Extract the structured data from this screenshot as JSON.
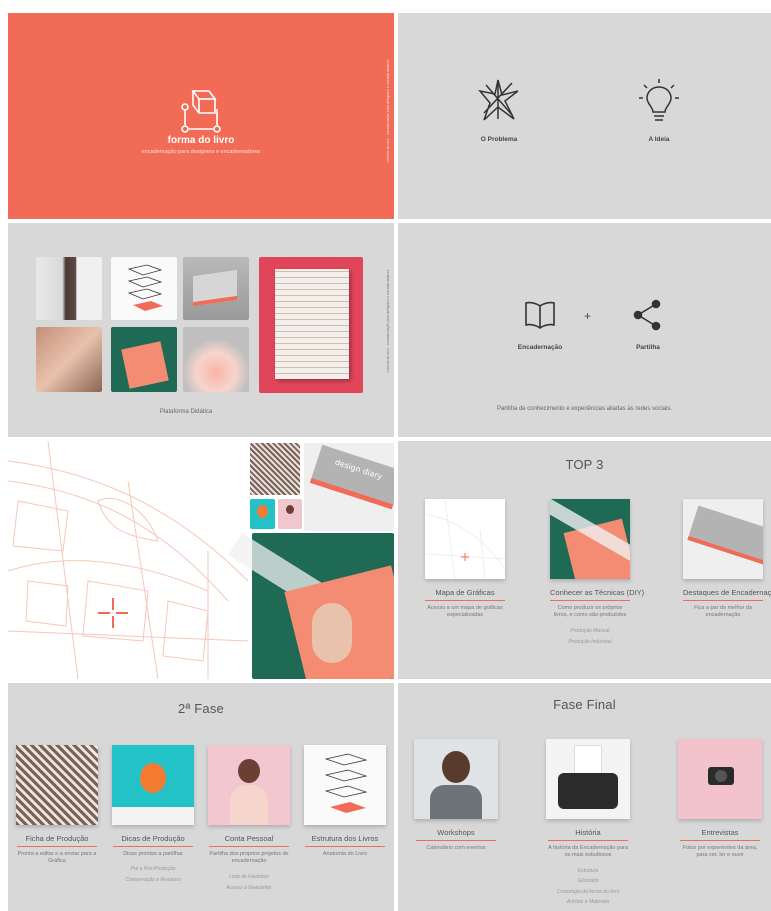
{
  "brand": {
    "name": "forma do livro",
    "tagline": "encadernação para designers e encadernadores",
    "vertical_note": "a forma do livro - encadernação para designers e encadernadores",
    "accent": "#f26b56",
    "bg_gray": "#d8d8d8"
  },
  "concepts": {
    "problem_label": "O Problema",
    "idea_label": "A Ideia",
    "problem_icon": "star-scribble-icon",
    "idea_icon": "lightbulb-icon"
  },
  "platform": {
    "caption": "Plataforma Didática"
  },
  "sharing": {
    "left_label": "Encadernação",
    "plus": "+",
    "right_label": "Partilha",
    "caption": "Partilha de conhecimento e experiências aliadas às redes sociais."
  },
  "top3": {
    "title": "TOP 3",
    "cards": [
      {
        "name": "Mapa de Gráficas",
        "desc": "Acesso a um mapa de gráficas especializadas",
        "subs": []
      },
      {
        "name": "Conhecer as Técnicas (DIY)",
        "desc": "Como produzir os próprios livros, e como são produzidos",
        "subs": [
          "Produção Manual",
          "Produção Industrial"
        ]
      },
      {
        "name": "Destaques de Encadernação",
        "desc": "Fica a par do melhor da encadernação",
        "subs": []
      }
    ]
  },
  "phase2": {
    "title": "2ª Fase",
    "cards": [
      {
        "name": "Ficha de Produção",
        "desc": "Pronta a editar e a enviar para a Gráfica",
        "subs": []
      },
      {
        "name": "Dicas de Produção",
        "desc": "Dicas prontas a partilhar",
        "subs": [
          "Pré e Pós-Produção",
          "Conservação e Restauro"
        ]
      },
      {
        "name": "Conta Pessoal",
        "desc": "Partilha dos proprios projetos de encadernação",
        "subs": [
          "Lista de Favoritos",
          "Acesso à Newsletter"
        ]
      },
      {
        "name": "Estrutura dos Livros",
        "desc": "Anatomia do Livro",
        "subs": []
      }
    ]
  },
  "final": {
    "title": "Fase Final",
    "cards": [
      {
        "name": "Workshops",
        "desc": "Calendário com eventos",
        "subs": []
      },
      {
        "name": "História",
        "desc": "A história da Encadernação para os mais estudiosos",
        "subs": [
          "Estrutura",
          "Glossário",
          "Cronologia da forma do livro",
          "Artistas e Materiais"
        ]
      },
      {
        "name": "Entrevistas",
        "desc": "Fotos por experientes da área, para ver, ler e ouvir",
        "subs": []
      }
    ]
  },
  "book_cover_text": "design diary"
}
